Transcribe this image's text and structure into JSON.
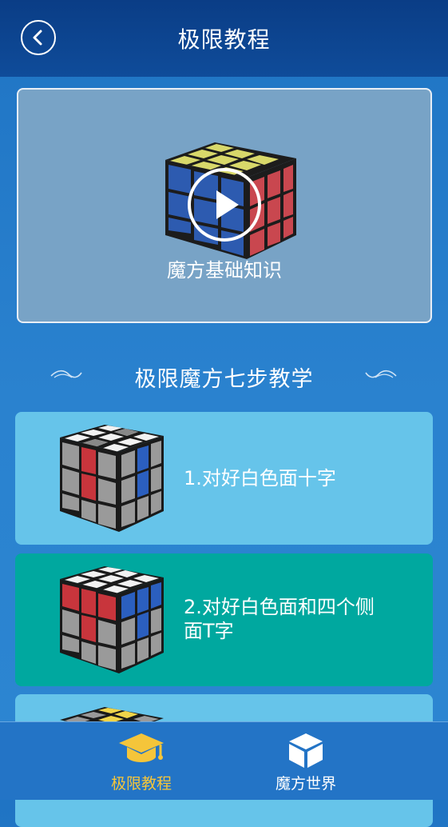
{
  "header": {
    "title": "极限教程",
    "back_icon": "chevron-left-icon"
  },
  "video": {
    "label": "魔方基础知识",
    "play_icon": "play-icon"
  },
  "section": {
    "title": "极限魔方七步教学"
  },
  "steps": [
    {
      "label": "1.对好白色面十字",
      "bg": "#66c4ea"
    },
    {
      "label_line1": "2.对好白色面和四个侧",
      "label_line2": "面T字",
      "bg": "#00a89f"
    },
    {
      "label": "",
      "bg": "#66c4ea"
    }
  ],
  "tabbar": {
    "items": [
      {
        "label": "极限教程",
        "icon": "graduation-cap-icon",
        "active": true,
        "color": "#f5c53a"
      },
      {
        "label": "魔方世界",
        "icon": "cube-icon",
        "active": false,
        "color": "#ffffff"
      }
    ]
  },
  "colors": {
    "header": "#0f4c9a",
    "background": "#2a82cf",
    "active_tab": "#f5c53a"
  }
}
